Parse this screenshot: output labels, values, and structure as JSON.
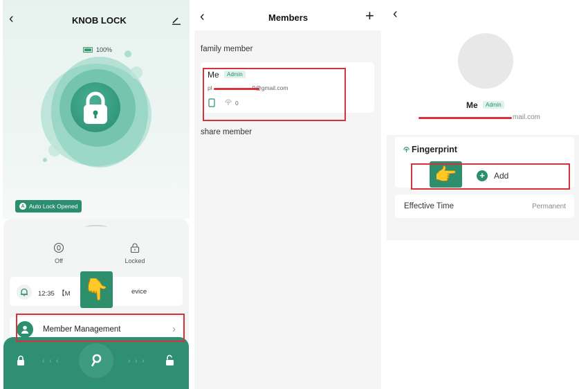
{
  "panel1": {
    "title": "KNOB LOCK",
    "battery": "100%",
    "auto_lock_badge": "Auto Lock Opened",
    "controls": [
      {
        "label": "Off",
        "icon": "zero-circle-icon"
      },
      {
        "label": "Locked",
        "icon": "padlock-icon"
      }
    ],
    "notification_time": "12:35",
    "notification_prefix": "【M",
    "notification_suffix": "evice",
    "member_management": "Member Management",
    "arrows_left": "‹ ‹ ‹",
    "arrows_right": "› › ›"
  },
  "panel2": {
    "title": "Members",
    "family_section": "family member",
    "share_section": "share member",
    "member_name": "Me",
    "admin_badge": "Admin",
    "email_start": "pl",
    "email_end": "9@gmail.com",
    "fingerprint_count": "0"
  },
  "panel3": {
    "name": "Me",
    "admin_badge": "Admin",
    "email_end": "mail.com",
    "fingerprint_title": "Fingerprint",
    "add_label": "Add",
    "effective_time_label": "Effective Time",
    "effective_time_value": "Permanent"
  },
  "colors": {
    "brand_green": "#2b8e6f",
    "highlight_red": "#d6303b"
  }
}
